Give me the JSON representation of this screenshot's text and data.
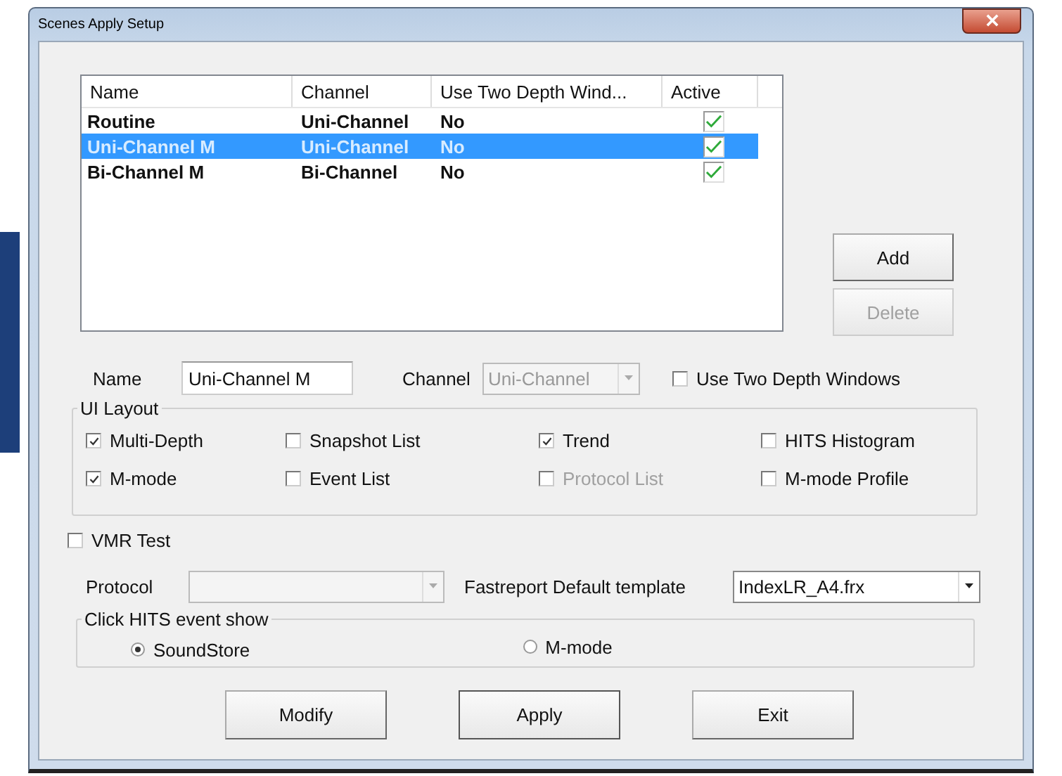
{
  "window": {
    "title": "Scenes Apply Setup"
  },
  "table": {
    "columns": [
      "Name",
      "Channel",
      "Use Two Depth Wind...",
      "Active"
    ],
    "rows": [
      {
        "name": "Routine",
        "channel": "Uni-Channel",
        "use_two_depth": "No",
        "active": true,
        "selected": false
      },
      {
        "name": "Uni-Channel M",
        "channel": "Uni-Channel",
        "use_two_depth": "No",
        "active": true,
        "selected": true
      },
      {
        "name": "Bi-Channel M",
        "channel": "Bi-Channel",
        "use_two_depth": "No",
        "active": true,
        "selected": false
      }
    ]
  },
  "side_buttons": [
    {
      "label": "Add",
      "disabled": false
    },
    {
      "label": "Delete",
      "disabled": true
    }
  ],
  "name_field": {
    "label": "Name",
    "value": "Uni-Channel M"
  },
  "channel_field": {
    "label": "Channel",
    "value": "Uni-Channel",
    "disabled": true
  },
  "use_two_depth": {
    "label": "Use Two Depth Windows",
    "checked": false
  },
  "ui_layout": {
    "title": "UI Layout",
    "options": [
      {
        "label": "Multi-Depth",
        "checked": true,
        "disabled": false
      },
      {
        "label": "Snapshot List",
        "checked": false,
        "disabled": false
      },
      {
        "label": "Trend",
        "checked": true,
        "disabled": false
      },
      {
        "label": "HITS Histogram",
        "checked": false,
        "disabled": false
      },
      {
        "label": "M-mode",
        "checked": true,
        "disabled": false
      },
      {
        "label": "Event List",
        "checked": false,
        "disabled": false
      },
      {
        "label": "Protocol List",
        "checked": false,
        "disabled": true
      },
      {
        "label": "M-mode Profile",
        "checked": false,
        "disabled": false
      }
    ]
  },
  "vmr_test": {
    "label": "VMR Test",
    "checked": false
  },
  "protocol": {
    "label": "Protocol",
    "disabled": true
  },
  "fastreport": {
    "label": "Fastreport Default template",
    "value": "IndexLR_A4.frx",
    "disabled": false
  },
  "click_hits": {
    "title": "Click HITS event show",
    "options": [
      {
        "label": "SoundStore",
        "selected": true
      },
      {
        "label": "M-mode",
        "selected": false
      }
    ]
  },
  "buttons": [
    {
      "label": "Modify",
      "focused": false
    },
    {
      "label": "Apply",
      "focused": true
    },
    {
      "label": "Exit",
      "focused": false
    }
  ]
}
